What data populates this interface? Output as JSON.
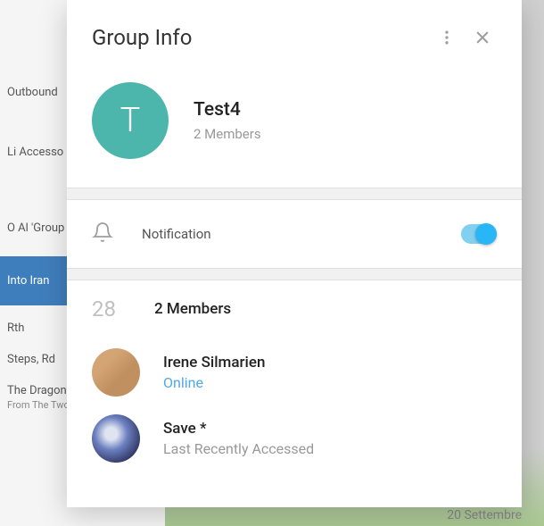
{
  "background": {
    "sidebar_items": [
      {
        "label": "Outbound"
      },
      {
        "label": "Li Accesso"
      },
      {
        "label": "O Al 'Group"
      },
      {
        "label": "Into Iran",
        "selected": true
      },
      {
        "label": "Rth"
      },
      {
        "label": "Steps, Rd"
      },
      {
        "label": "The Dragon",
        "sub": "From The Two"
      }
    ],
    "main_date": "20 Settembre"
  },
  "modal": {
    "title": "Group Info",
    "avatar_letter": "T",
    "group_name": "Test4",
    "member_count_text": "2 Members",
    "notification_label": "Notification",
    "notification_on": true,
    "members_icon_text": "28",
    "members_header": "2 Members",
    "members": [
      {
        "name": "Irene Silmarien",
        "status": "Online",
        "online": true
      },
      {
        "name": "Save *",
        "status": "Last Recently Accessed",
        "online": false
      }
    ]
  }
}
